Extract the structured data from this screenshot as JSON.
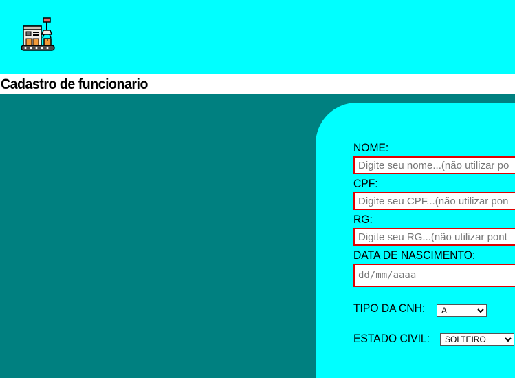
{
  "header": {
    "logo_icon": "factory-robot-arm-icon",
    "background": "#00FFFF"
  },
  "page": {
    "title": "Cadastro de funcionario",
    "background": "#008080"
  },
  "form": {
    "panel_color": "#00FFFF",
    "field_border_color": "#E00000",
    "nome_label": "NOME:",
    "nome_placeholder": "Digite seu nome...(não utilizar po",
    "cpf_label": "CPF:",
    "cpf_placeholder": "Digite seu CPF...(não utilizar pon",
    "rg_label": "RG:",
    "rg_placeholder": "Digite seu RG...(não utilizar pont",
    "nascimento_label": "DATA DE NASCIMENTO:",
    "nascimento_value": "dd/mm/aaaa",
    "cnh_label": "TIPO DA CNH:",
    "cnh_selected": "A",
    "estado_civil_label": "ESTADO CIVIL:",
    "estado_civil_selected": "SOLTEIRO"
  }
}
